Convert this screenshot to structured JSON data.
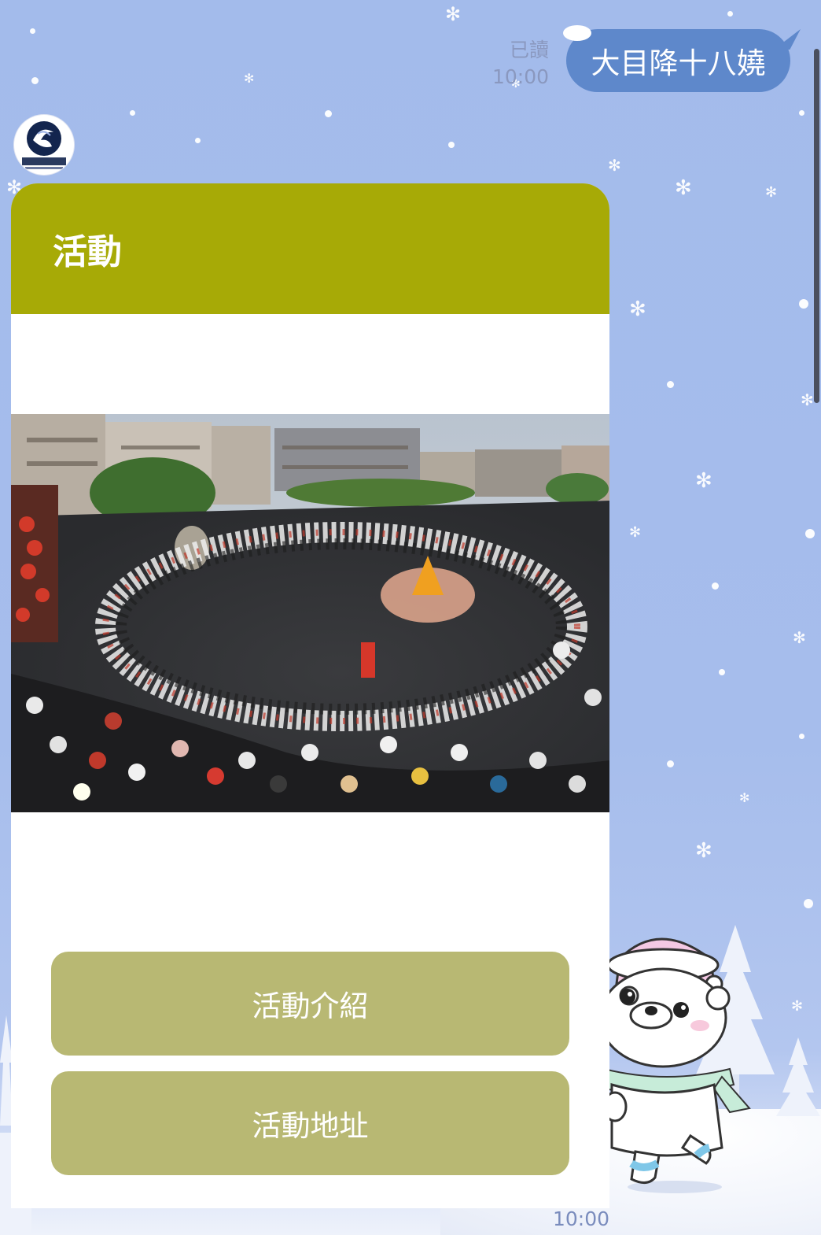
{
  "outgoing": {
    "read_label": "已讀",
    "time": "10:00",
    "text": "大目降十八嬈"
  },
  "incoming": {
    "avatar": "ministry-of-culture-logo",
    "card": {
      "header": "活動",
      "photo": "temple-festival-crowd-photo",
      "buttons": [
        {
          "label": "活動介紹"
        },
        {
          "label": "活動地址"
        }
      ]
    },
    "time": "10:00"
  },
  "colors": {
    "chat_background": "#a4bbea",
    "outgoing_bubble": "#5e88cb",
    "card_header": "#a7aa06",
    "card_button": "#b8b873"
  }
}
